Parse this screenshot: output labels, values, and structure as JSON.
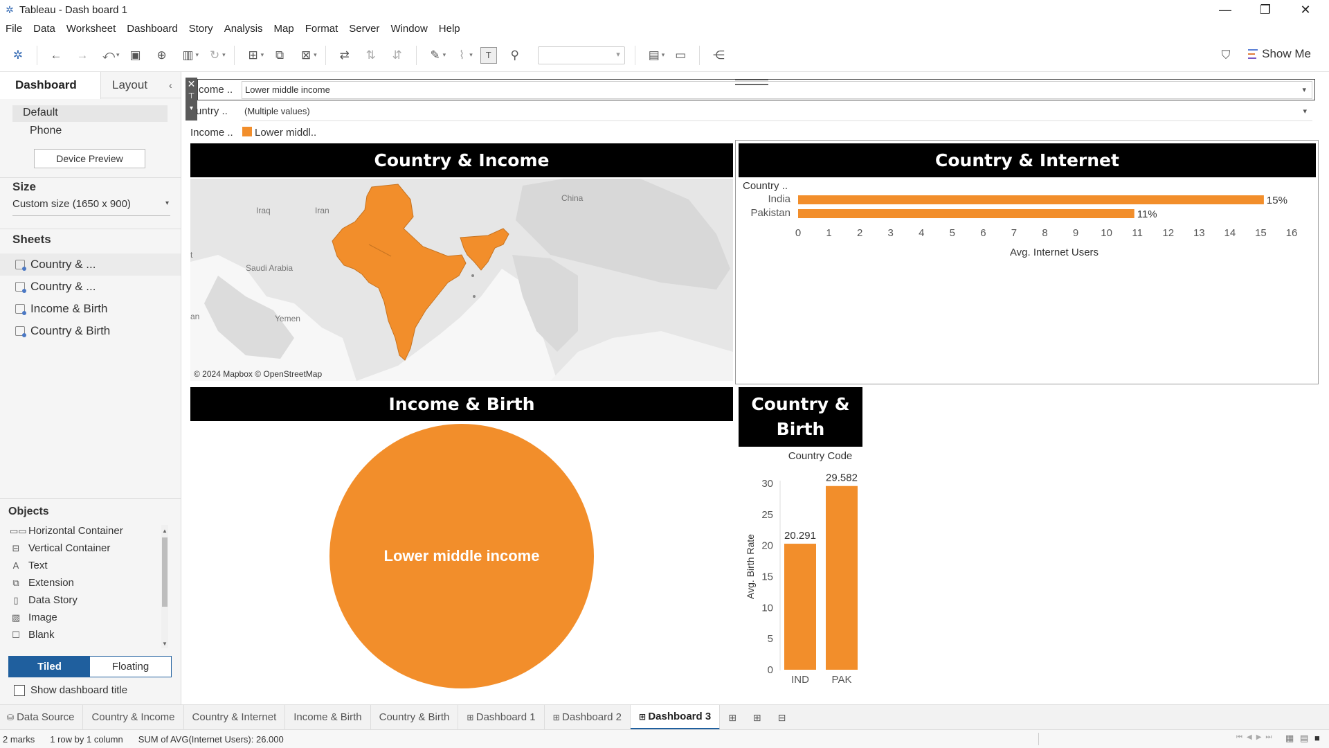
{
  "window": {
    "title": "Tableau - Dash board 1",
    "minimize": "—",
    "restore": "❐",
    "close": "✕"
  },
  "menu": [
    "File",
    "Data",
    "Worksheet",
    "Dashboard",
    "Story",
    "Analysis",
    "Map",
    "Format",
    "Server",
    "Window",
    "Help"
  ],
  "toolbar": {
    "show_me": "Show Me"
  },
  "left_panel": {
    "tabs": [
      "Dashboard",
      "Layout"
    ],
    "device": {
      "options": [
        "Default",
        "Phone"
      ],
      "preview_button": "Device Preview"
    },
    "size": {
      "title": "Size",
      "value": "Custom size (1650 x 900)"
    },
    "sheets": {
      "title": "Sheets",
      "items": [
        "Country & ...",
        "Country & ...",
        "Income & Birth",
        "Country & Birth"
      ]
    },
    "objects": {
      "title": "Objects",
      "items": [
        {
          "label": "Horizontal Container",
          "icon": "horizontal-container-icon",
          "glyph": "▭▭"
        },
        {
          "label": "Vertical Container",
          "icon": "vertical-container-icon",
          "glyph": "⊟"
        },
        {
          "label": "Text",
          "icon": "text-icon",
          "glyph": "A"
        },
        {
          "label": "Extension",
          "icon": "extension-icon",
          "glyph": "⧉"
        },
        {
          "label": "Data Story",
          "icon": "data-story-icon",
          "glyph": "▯"
        },
        {
          "label": "Image",
          "icon": "image-icon",
          "glyph": "▨"
        },
        {
          "label": "Blank",
          "icon": "blank-icon",
          "glyph": "☐"
        }
      ],
      "layout_buttons": [
        "Tiled",
        "Floating"
      ],
      "show_title_label": "Show dashboard title"
    }
  },
  "filters": [
    {
      "label": "come ..",
      "value": "Lower middle income"
    },
    {
      "label": "untry ..",
      "value": "(Multiple values)"
    }
  ],
  "legend": {
    "label": "Income ..",
    "item": "Lower middl..",
    "color": "#f28e2b"
  },
  "map": {
    "title": "Country & Income",
    "labels": [
      "Iraq",
      "Iran",
      "China",
      "Saudi Arabia",
      "Yemen",
      "an",
      "t"
    ],
    "attribution": "© 2024 Mapbox © OpenStreetMap",
    "highlight_color": "#f28e2b"
  },
  "internet": {
    "title": "Country & Internet",
    "row_header": "Country ..",
    "axis_label": "Avg. Internet Users",
    "ticks": [
      "0",
      "1",
      "2",
      "3",
      "4",
      "5",
      "6",
      "7",
      "8",
      "9",
      "10",
      "11",
      "12",
      "13",
      "14",
      "15",
      "16"
    ]
  },
  "pie": {
    "title": "Income & Birth",
    "label": "Lower middle income"
  },
  "birth": {
    "title_line1": "Country &",
    "title_line2": "Birth",
    "header": "Country Code",
    "ylabel": "Avg. Birth Rate",
    "yticks": [
      "0",
      "5",
      "10",
      "15",
      "20",
      "25",
      "30"
    ]
  },
  "chart_data": [
    {
      "type": "bar",
      "orientation": "horizontal",
      "title": "Country & Internet",
      "categories": [
        "India",
        "Pakistan"
      ],
      "values": [
        15.1,
        10.9
      ],
      "labels": [
        "15%",
        "11%"
      ],
      "xlabel": "Avg. Internet Users",
      "xlim": [
        0,
        16
      ],
      "color": "#f28e2b"
    },
    {
      "type": "bar",
      "title": "Country & Birth",
      "categories": [
        "IND",
        "PAK"
      ],
      "values": [
        20.291,
        29.582
      ],
      "labels": [
        "20.291",
        "29.582"
      ],
      "ylabel": "Avg. Birth Rate",
      "xlabel": "Country Code",
      "ylim": [
        0,
        30
      ],
      "color": "#f28e2b"
    },
    {
      "type": "pie",
      "title": "Income & Birth",
      "categories": [
        "Lower middle income"
      ],
      "values": [
        1
      ],
      "color": "#f28e2b"
    }
  ],
  "tabs": {
    "data_source": "Data Source",
    "sheets": [
      "Country & Income",
      "Country & Internet",
      "Income & Birth",
      "Country & Birth",
      "Dashboard 1",
      "Dashboard 2",
      "Dashboard 3"
    ],
    "active": "Dashboard 3"
  },
  "status": {
    "marks": "2 marks",
    "rows": "1 row by 1 column",
    "sum": "SUM of AVG(Internet Users): 26.000"
  }
}
